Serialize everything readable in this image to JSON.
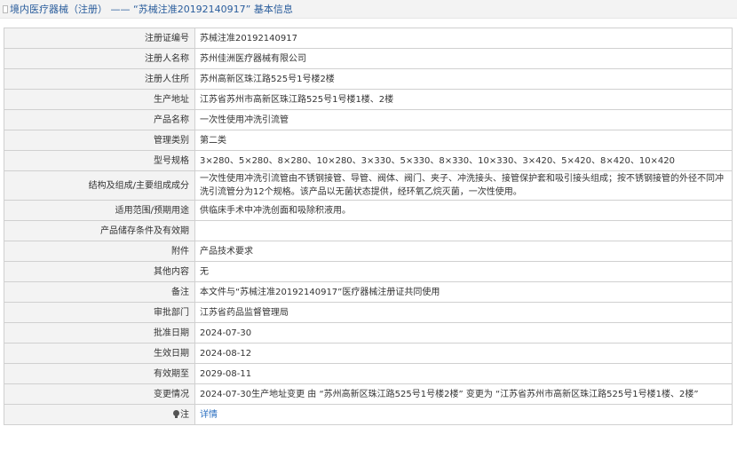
{
  "header": {
    "title": "境内医疗器械（注册） —— “苏械注准20192140917” 基本信息"
  },
  "rows": [
    {
      "label": "注册证编号",
      "value": "苏械注准20192140917"
    },
    {
      "label": "注册人名称",
      "value": "苏州佳洲医疗器械有限公司"
    },
    {
      "label": "注册人住所",
      "value": "苏州高新区珠江路525号1号楼2楼"
    },
    {
      "label": "生产地址",
      "value": "江苏省苏州市高新区珠江路525号1号楼1楼、2楼"
    },
    {
      "label": "产品名称",
      "value": "一次性使用冲洗引流管"
    },
    {
      "label": "管理类别",
      "value": "第二类"
    },
    {
      "label": "型号规格",
      "value": "3×280、5×280、8×280、10×280、3×330、5×330、8×330、10×330、3×420、5×420、8×420、10×420"
    },
    {
      "label": "结构及组成/主要组成成分",
      "value": "一次性使用冲洗引流管由不锈钢接管、导管、阀体、阀门、夹子、冲洗接头、接管保护套和吸引接头组成；按不锈钢接管的外径不同冲洗引流管分为12个规格。该产品以无菌状态提供，经环氧乙烷灭菌，一次性使用。"
    },
    {
      "label": "适用范围/预期用途",
      "value": "供临床手术中冲洗创面和吸除积液用。"
    },
    {
      "label": "产品储存条件及有效期",
      "value": ""
    },
    {
      "label": "附件",
      "value": "产品技术要求"
    },
    {
      "label": "其他内容",
      "value": "无"
    },
    {
      "label": "备注",
      "value": "本文件与“苏械注准20192140917”医疗器械注册证共同使用"
    },
    {
      "label": "审批部门",
      "value": "江苏省药品监督管理局"
    },
    {
      "label": "批准日期",
      "value": "2024-07-30"
    },
    {
      "label": "生效日期",
      "value": "2024-08-12"
    },
    {
      "label": "有效期至",
      "value": "2029-08-11"
    },
    {
      "label": "变更情况",
      "value": "2024-07-30生产地址变更 由 “苏州高新区珠江路525号1号楼2楼” 变更为 “江苏省苏州市高新区珠江路525号1号楼1楼、2楼”"
    }
  ],
  "footer": {
    "label": "注",
    "link": "详情"
  }
}
